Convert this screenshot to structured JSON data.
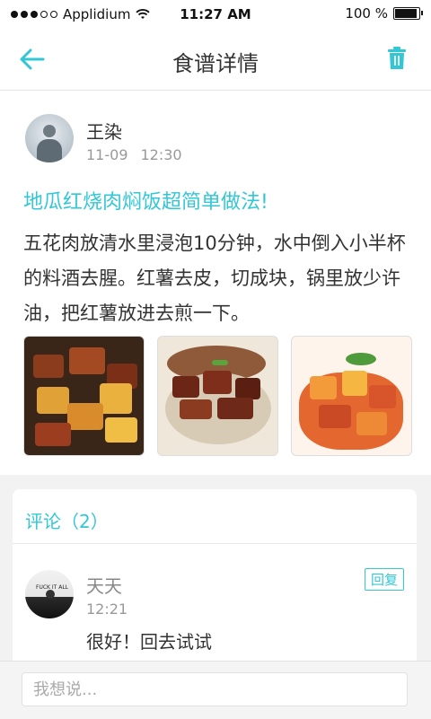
{
  "status_bar": {
    "carrier": "Applidium",
    "time": "11:27 AM",
    "battery": "100 %",
    "battery_level": 1.0
  },
  "nav": {
    "title": "食谱详情",
    "back_icon": "arrow-left-icon",
    "delete_icon": "trash-icon",
    "accent_color": "#33c7d6"
  },
  "post": {
    "author": "王染",
    "date": "11-09",
    "time": "12:30",
    "title": "地瓜红烧肉焖饭超简单做法!",
    "body": "五花肉放清水里浸泡10分钟，水中倒入小半杯的料酒去腥。红薯去皮，切成块，锅里放少许油，把红薯放进去煎一下。"
  },
  "comments": {
    "header": "评论（2）",
    "items": [
      {
        "name": "天天",
        "time": "12:21",
        "text": "很好！回去试试",
        "reply_label": "回复"
      }
    ]
  },
  "input": {
    "placeholder": "我想说..."
  }
}
